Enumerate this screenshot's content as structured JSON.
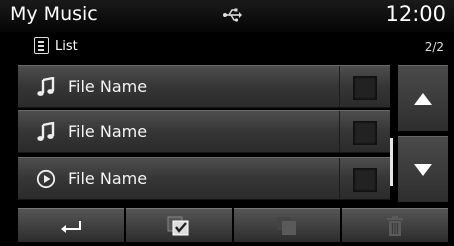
{
  "status_bar": {
    "title": "My Music",
    "usb_icon": "usb-icon",
    "time": "12:00"
  },
  "subheader": {
    "icon": "list-icon",
    "label": "List",
    "page": "2/2"
  },
  "rows": [
    {
      "icon": "music-note-icon",
      "label": "File Name",
      "checked": false
    },
    {
      "icon": "music-note-icon",
      "label": "File Name",
      "checked": false
    },
    {
      "icon": "play-circle-icon",
      "label": "File Name",
      "checked": false
    }
  ],
  "scroll": {
    "up_icon": "arrow-up-icon",
    "down_icon": "arrow-down-icon"
  },
  "toolbar": {
    "buttons": [
      {
        "icon": "back-icon",
        "enabled": true
      },
      {
        "icon": "select-all-icon",
        "enabled": true
      },
      {
        "icon": "copy-icon",
        "enabled": false
      },
      {
        "icon": "trash-icon",
        "enabled": false
      }
    ]
  },
  "colors": {
    "background": "#000000",
    "row_bg": "#3a3a3a",
    "text": "#ffffff",
    "disabled_icon": "#5a5a5a"
  }
}
